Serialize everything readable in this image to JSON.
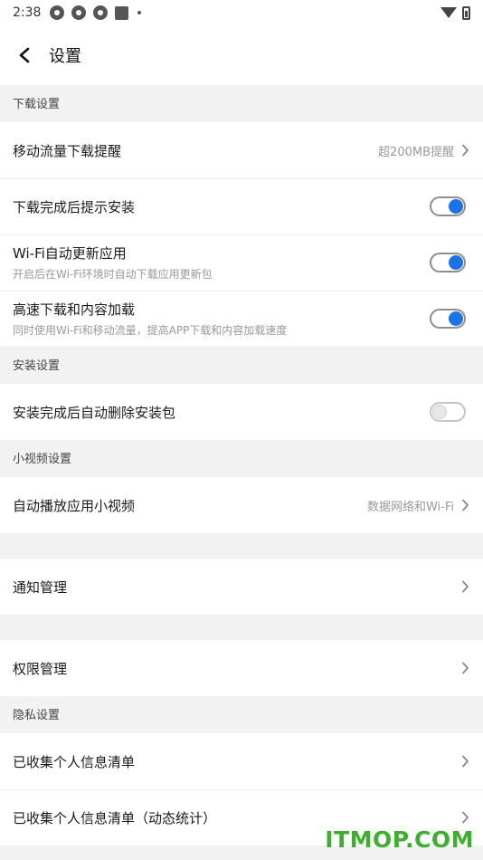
{
  "status_bar": {
    "time": "2:38"
  },
  "header": {
    "title": "设置"
  },
  "sections": {
    "download": {
      "title": "下载设置",
      "mobile_data": {
        "label": "移动流量下载提醒",
        "value": "超200MB提醒"
      },
      "prompt_install": {
        "label": "下载完成后提示安装",
        "on": true
      },
      "wifi_update": {
        "label": "Wi-Fi自动更新应用",
        "sub": "开启后在Wi-Fi环境时自动下载应用更新包",
        "on": true
      },
      "high_speed": {
        "label": "高速下载和内容加载",
        "sub": "同时使用Wi-Fi和移动流量，提高APP下载和内容加载速度",
        "on": true
      }
    },
    "install": {
      "title": "安装设置",
      "auto_delete": {
        "label": "安装完成后自动删除安装包",
        "on": false
      }
    },
    "video": {
      "title": "小视频设置",
      "autoplay": {
        "label": "自动播放应用小视频",
        "value": "数据网络和Wi-Fi"
      }
    },
    "notification": {
      "label": "通知管理"
    },
    "permission": {
      "label": "权限管理"
    },
    "privacy": {
      "title": "隐私设置",
      "collected_list": {
        "label": "已收集个人信息清单"
      },
      "collected_dynamic": {
        "label": "已收集个人信息清单（动态统计）"
      }
    }
  },
  "watermark": "ITMOP.COM",
  "colors": {
    "toggle_on": "#1a73e8",
    "watermark": "#3cb02c"
  }
}
